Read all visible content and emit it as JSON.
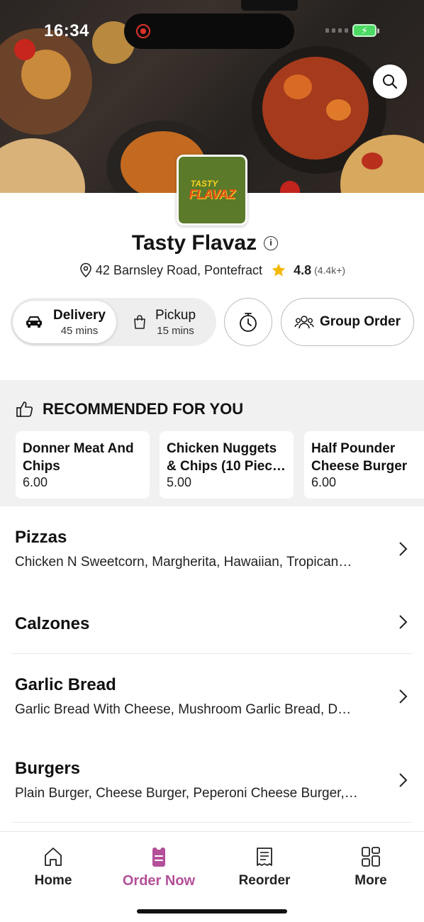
{
  "status_bar": {
    "time": "16:34"
  },
  "restaurant": {
    "name": "Tasty Flavaz",
    "logo_text_top": "TASTY",
    "logo_text_bottom": "FLAVAZ",
    "address": "42 Barnsley Road, Pontefract",
    "rating": "4.8",
    "reviews": "(4.4k+)"
  },
  "order_mode": {
    "delivery": {
      "label": "Delivery",
      "time": "45 mins"
    },
    "pickup": {
      "label": "Pickup",
      "time": "15 mins"
    },
    "group_order_label": "Group Order"
  },
  "recommended": {
    "title": "RECOMMENDED FOR YOU",
    "items": [
      {
        "name": "Donner Meat And Chips",
        "price": "6.00"
      },
      {
        "name": "Chicken Nuggets & Chips (10 Piec…",
        "price": "5.00"
      },
      {
        "name": "Half Pounder Cheese Burger",
        "price": "6.00"
      }
    ]
  },
  "categories": [
    {
      "title": "Pizzas",
      "subtitle": "Chicken N Sweetcorn, Margherita, Hawaiian, Tropican…"
    },
    {
      "title": "Calzones",
      "subtitle": ""
    },
    {
      "title": "Garlic Bread",
      "subtitle": "Garlic Bread With Cheese, Mushroom Garlic Bread, D…"
    },
    {
      "title": "Burgers",
      "subtitle": "Plain Burger, Cheese Burger, Peperoni Cheese Burger,…"
    }
  ],
  "tabbar": {
    "items": [
      {
        "label": "Home"
      },
      {
        "label": "Order Now"
      },
      {
        "label": "Reorder"
      },
      {
        "label": "More"
      }
    ],
    "active_color": "#b4509a"
  },
  "colors": {
    "accent": "#b4509a",
    "star": "#f5b800",
    "logo_bg": "#5b7a2a"
  }
}
